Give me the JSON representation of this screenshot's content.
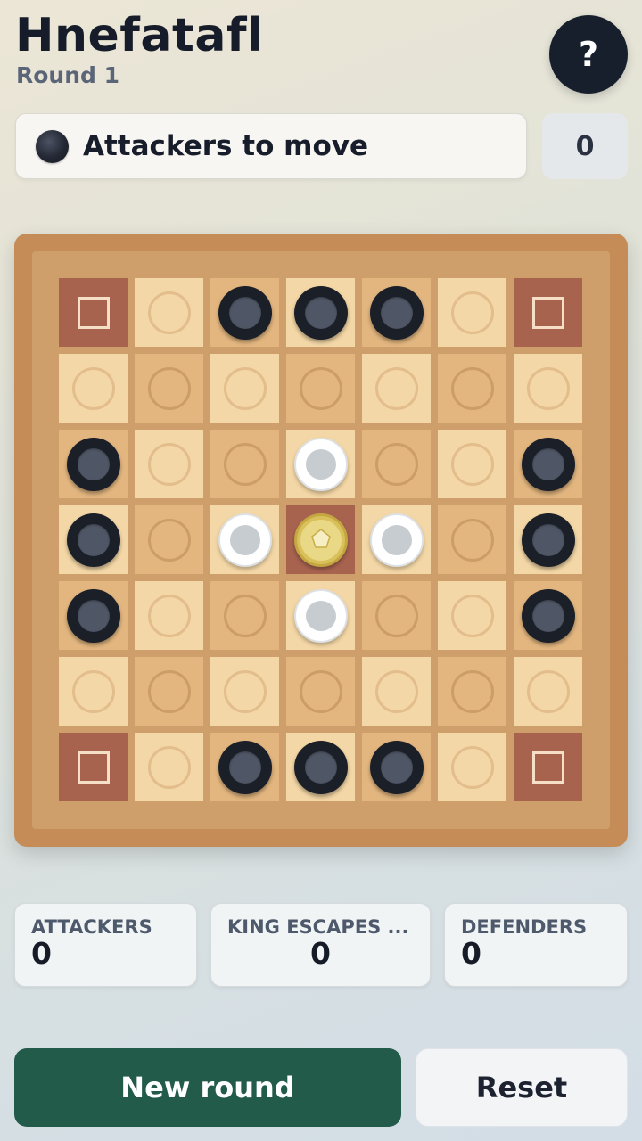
{
  "header": {
    "title": "Hnefatafl",
    "subtitle": "Round 1",
    "help_label": "?"
  },
  "status": {
    "text": "Attackers to move",
    "current_side": "attacker",
    "move_count": "0"
  },
  "board": {
    "size": 7,
    "corners": [
      [
        0,
        0
      ],
      [
        0,
        6
      ],
      [
        6,
        0
      ],
      [
        6,
        6
      ]
    ],
    "throne": [
      3,
      3
    ],
    "pieces": [
      {
        "type": "attacker",
        "row": 0,
        "col": 2
      },
      {
        "type": "attacker",
        "row": 0,
        "col": 3
      },
      {
        "type": "attacker",
        "row": 0,
        "col": 4
      },
      {
        "type": "attacker",
        "row": 2,
        "col": 0
      },
      {
        "type": "attacker",
        "row": 3,
        "col": 0
      },
      {
        "type": "attacker",
        "row": 4,
        "col": 0
      },
      {
        "type": "attacker",
        "row": 2,
        "col": 6
      },
      {
        "type": "attacker",
        "row": 3,
        "col": 6
      },
      {
        "type": "attacker",
        "row": 4,
        "col": 6
      },
      {
        "type": "attacker",
        "row": 6,
        "col": 2
      },
      {
        "type": "attacker",
        "row": 6,
        "col": 3
      },
      {
        "type": "attacker",
        "row": 6,
        "col": 4
      },
      {
        "type": "defender",
        "row": 2,
        "col": 3
      },
      {
        "type": "defender",
        "row": 3,
        "col": 2
      },
      {
        "type": "defender",
        "row": 3,
        "col": 4
      },
      {
        "type": "defender",
        "row": 4,
        "col": 3
      },
      {
        "type": "king",
        "row": 3,
        "col": 3
      }
    ]
  },
  "scores": {
    "attackers": {
      "label": "ATTACKERS",
      "value": "0"
    },
    "king_escapes": {
      "label": "KING ESCAPES ...",
      "value": "0"
    },
    "defenders": {
      "label": "DEFENDERS",
      "value": "0"
    }
  },
  "buttons": {
    "new_round": "New round",
    "reset": "Reset"
  }
}
